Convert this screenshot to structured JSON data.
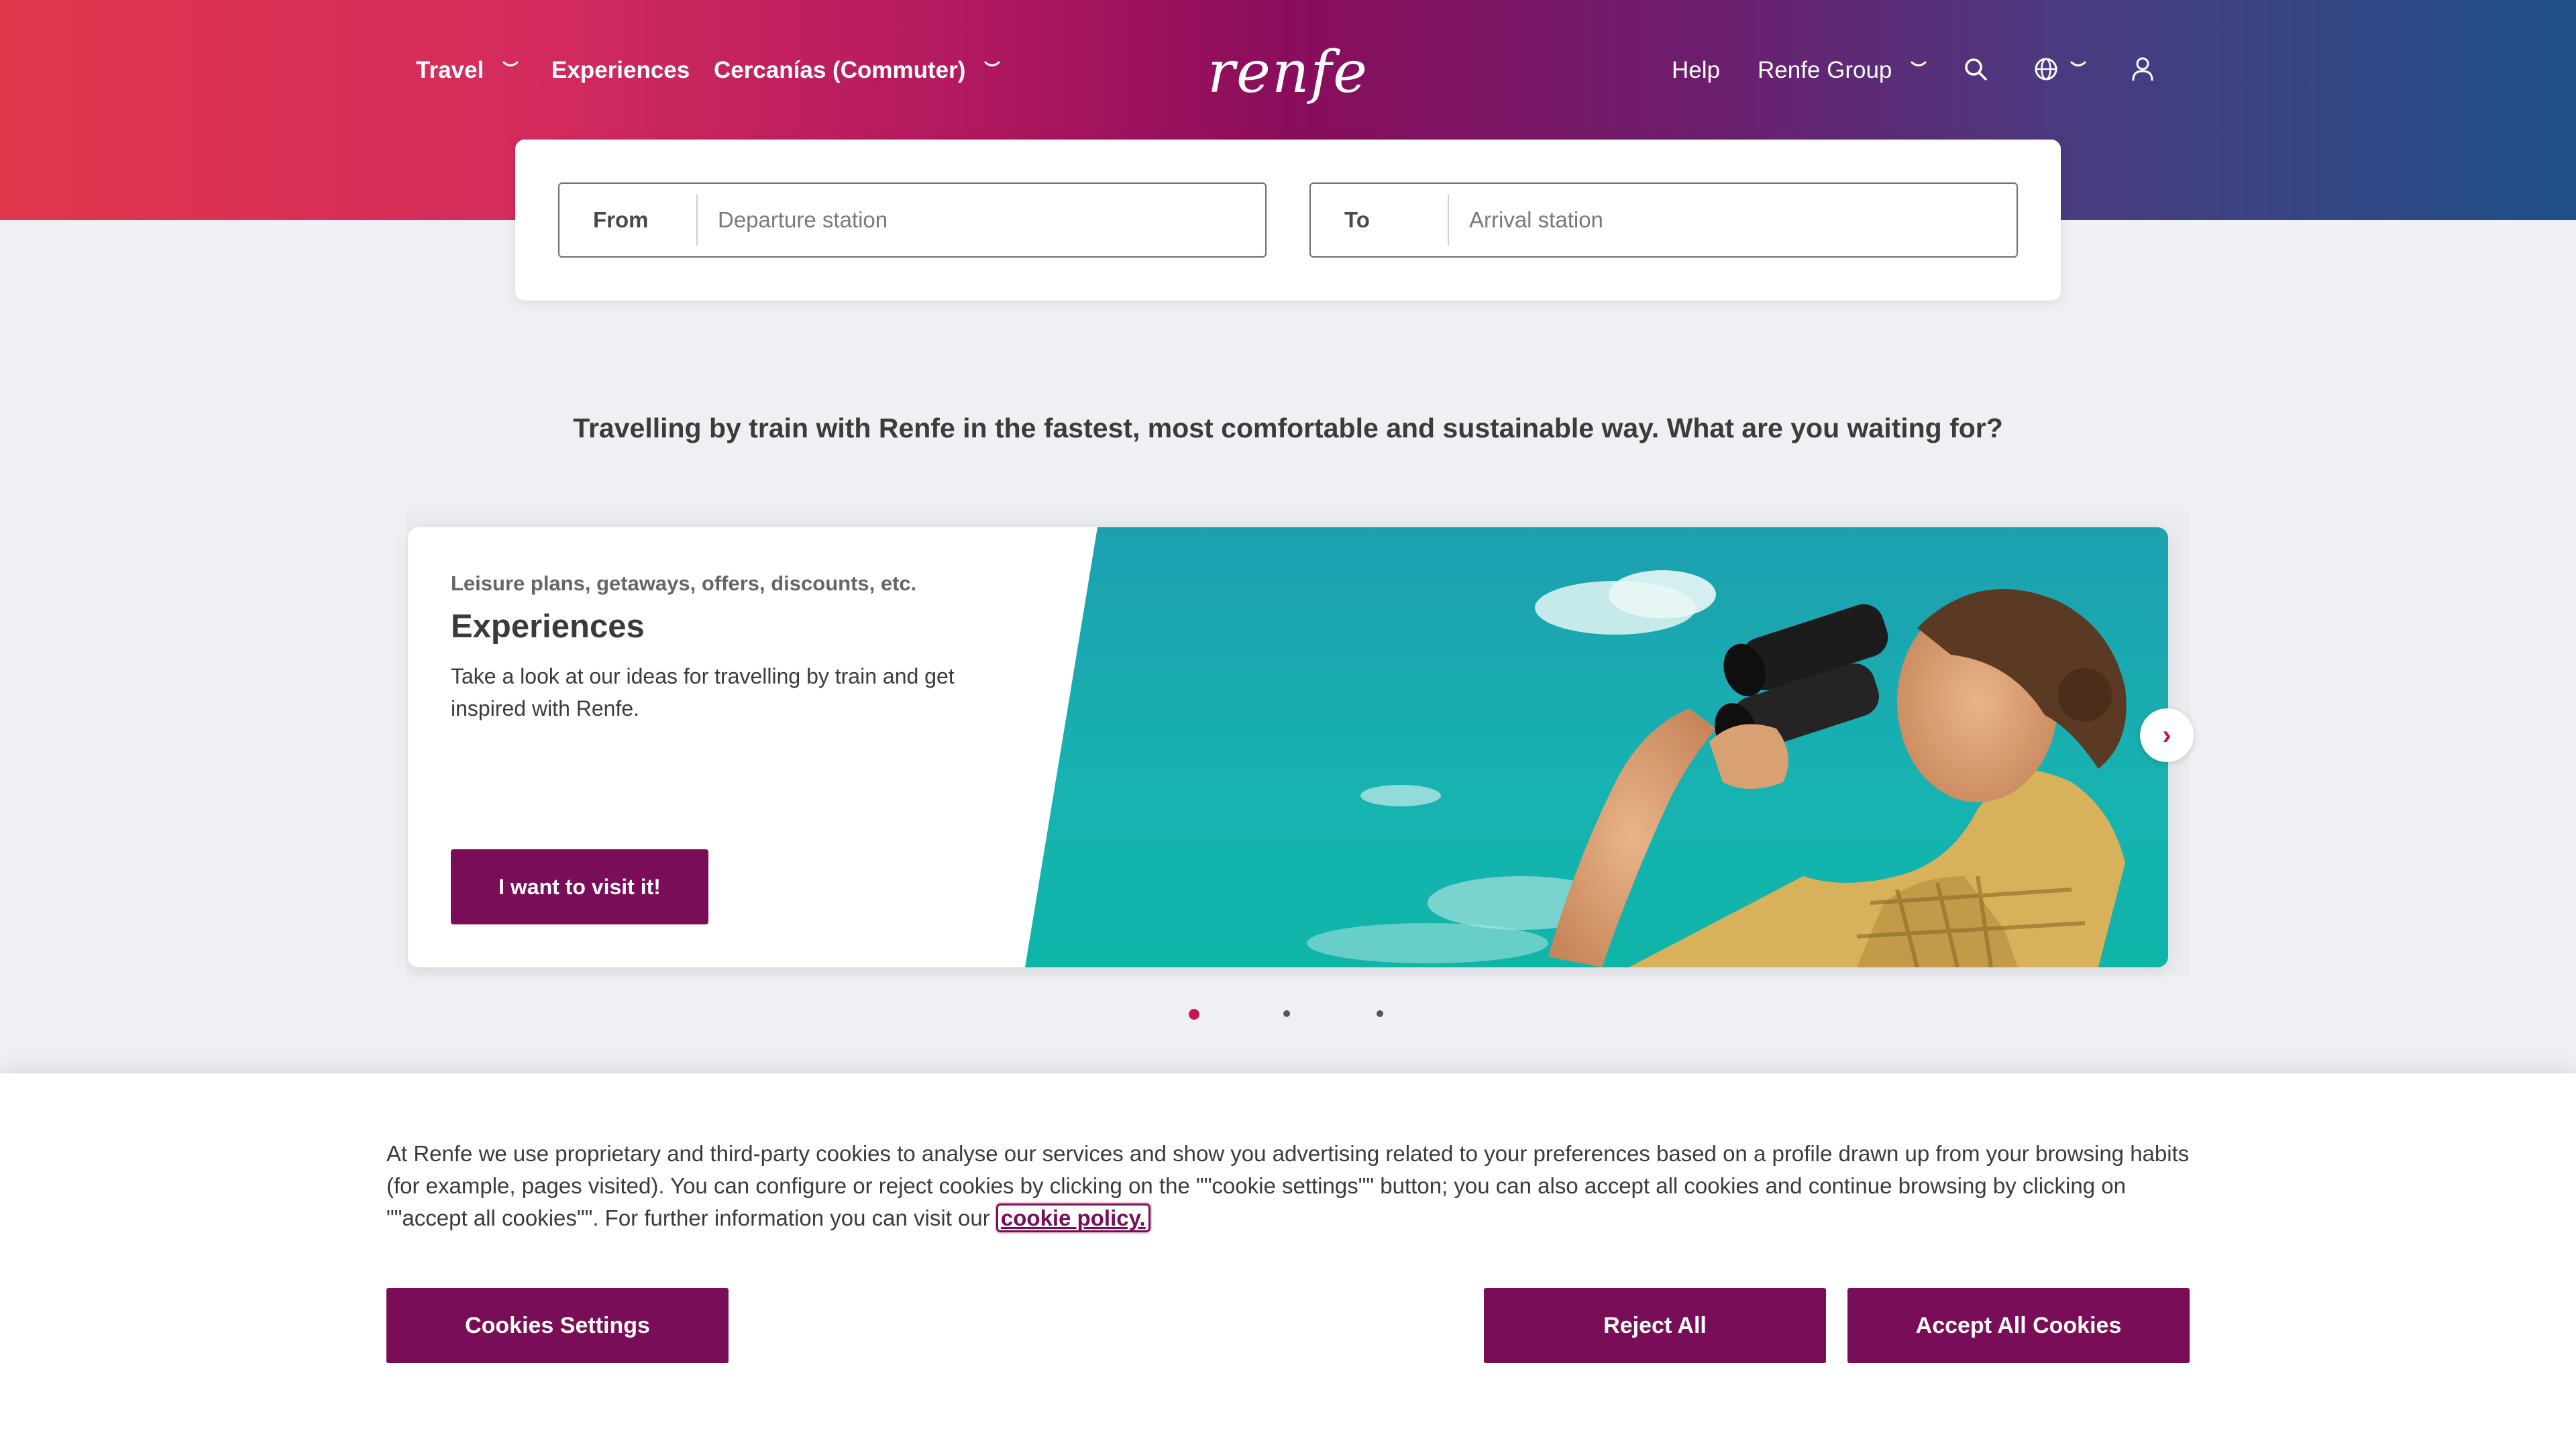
{
  "colors": {
    "brand_primary": "#790d57",
    "accent_pink": "#c2185b",
    "gradient_start": "#e0374c",
    "gradient_mid": "#8a0d5c",
    "gradient_end": "#1f5088",
    "page_bg": "#eef0f3"
  },
  "header": {
    "logo_text": "renfe",
    "nav_left": [
      {
        "label": "Travel",
        "has_dropdown": true
      },
      {
        "label": "Experiences",
        "has_dropdown": false
      },
      {
        "label": "Cercanías (Commuter)",
        "has_dropdown": true
      }
    ],
    "nav_right": {
      "help_label": "Help",
      "group_label": "Renfe Group",
      "icons": [
        "search-icon",
        "globe-icon",
        "user-icon"
      ]
    }
  },
  "search": {
    "from_label": "From",
    "from_placeholder": "Departure station",
    "from_value": "",
    "to_label": "To",
    "to_placeholder": "Arrival station",
    "to_value": ""
  },
  "tagline": "Travelling by train with Renfe in the fastest, most comfortable and sustainable way. What are you waiting for?",
  "carousel": {
    "active_index": 0,
    "slide_count": 3,
    "slide": {
      "kicker": "Leisure plans, getaways, offers, discounts, etc.",
      "title": "Experiences",
      "description": "Take a look at our ideas for travelling by train and get inspired with Renfe.",
      "cta_label": "I want to visit it!"
    },
    "next_glyph": "›"
  },
  "cookies": {
    "text": "At Renfe we use proprietary and third-party cookies to analyse our services and show you advertising related to your preferences based on a profile drawn up from your browsing habits (for example, pages visited). You can configure or reject cookies by clicking on the \"\"cookie settings\"\" button; you can also accept all cookies and continue browsing by clicking on \"\"accept all cookies\"\". For further information you can visit our",
    "link_label": "cookie policy.",
    "settings_label": "Cookies Settings",
    "reject_label": "Reject All",
    "accept_label": "Accept All Cookies"
  }
}
